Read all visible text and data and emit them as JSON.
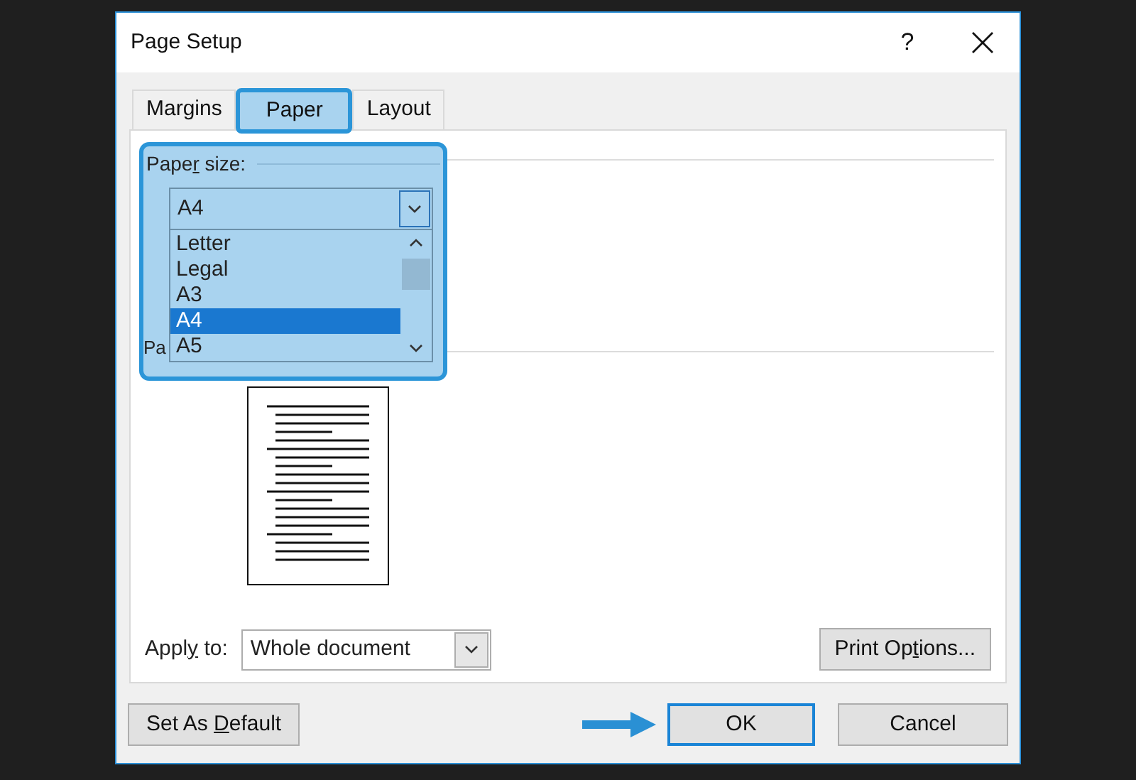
{
  "window": {
    "title": "Page Setup",
    "help": "?"
  },
  "tabs": [
    {
      "label": "Margins",
      "selected": false
    },
    {
      "label": "Paper",
      "selected": true
    },
    {
      "label": "Layout",
      "selected": false
    }
  ],
  "paper_size": {
    "label": {
      "before": "Pape",
      "key": "r",
      "after": " size:"
    },
    "value": "A4",
    "options": [
      {
        "label": "Letter",
        "selected": false
      },
      {
        "label": "Legal",
        "selected": false
      },
      {
        "label": "A3",
        "selected": false
      },
      {
        "label": "A4",
        "selected": true
      },
      {
        "label": "A5",
        "selected": false
      }
    ]
  },
  "paper_source": {
    "label": "Pa"
  },
  "apply_to": {
    "label": {
      "before": "Appl",
      "key": "y",
      "after": " to:"
    },
    "value": "Whole document"
  },
  "print_options": {
    "before": "Print Op",
    "key": "t",
    "after": "ions..."
  },
  "buttons": [
    {
      "before": "Set As ",
      "key": "D",
      "after": "efault",
      "kind": "left",
      "default": false
    },
    {
      "before": "OK",
      "kind": "right",
      "default": true
    },
    {
      "before": "Cancel",
      "kind": "right",
      "default": false
    }
  ]
}
